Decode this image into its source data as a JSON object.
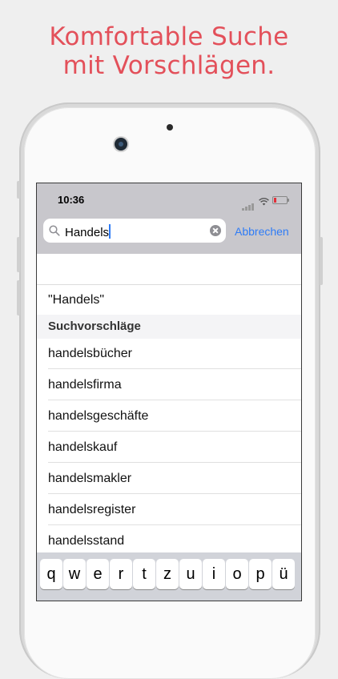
{
  "headline": {
    "line1": "Komfortable Suche",
    "line2": "mit Vorschlägen."
  },
  "status_bar": {
    "time": "10:36"
  },
  "search": {
    "value": "Handels",
    "cancel_label": "Abbrechen"
  },
  "results": {
    "query_item": "\"Handels\"",
    "section_title": "Suchvorschläge",
    "suggestions": [
      "handelsbücher",
      "handelsfirma",
      "handelsgeschäfte",
      "handelskauf",
      "handelsmakler",
      "handelsregister",
      "handelsstand"
    ]
  },
  "keyboard": {
    "keys": [
      "q",
      "w",
      "e",
      "r",
      "t",
      "z",
      "u",
      "i",
      "o",
      "p",
      "ü"
    ]
  },
  "colors": {
    "accent": "#e3505a",
    "link": "#2f7cf6",
    "status_bar_bg": "#c8c7cc",
    "battery_low": "#e2303a"
  }
}
